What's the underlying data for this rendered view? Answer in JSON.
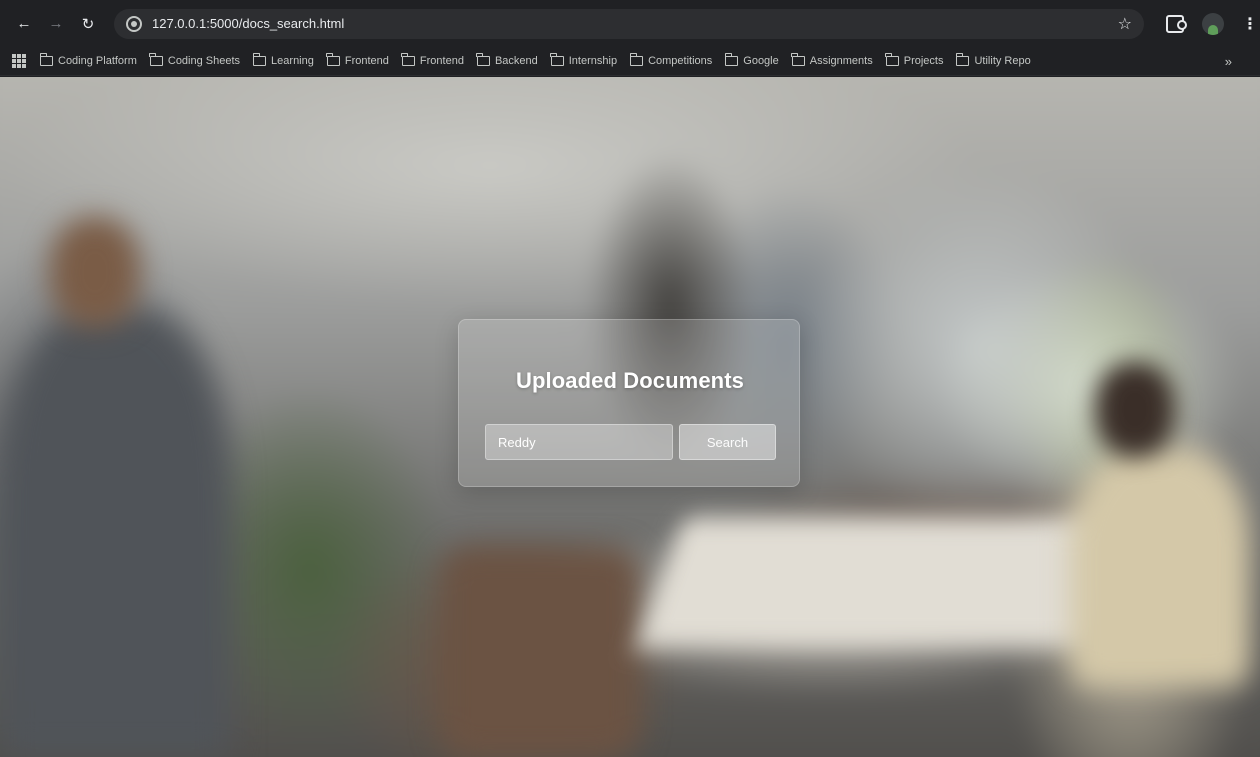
{
  "browser": {
    "url": "127.0.0.1:5000/docs_search.html",
    "nav": {
      "back_icon": "arrow-left-icon",
      "forward_icon": "arrow-right-icon",
      "reload_icon": "reload-icon"
    },
    "toolbar_icons": [
      "star-icon",
      "extensions-icon",
      "avatar",
      "menu-icon"
    ],
    "bookmarks": [
      {
        "label": "Coding Platform"
      },
      {
        "label": "Coding Sheets"
      },
      {
        "label": "Learning"
      },
      {
        "label": "Frontend"
      },
      {
        "label": "Frontend"
      },
      {
        "label": "Backend"
      },
      {
        "label": "Internship"
      },
      {
        "label": "Competitions"
      },
      {
        "label": "Google"
      },
      {
        "label": "Assignments"
      },
      {
        "label": "Projects"
      },
      {
        "label": "Utility Repo"
      }
    ],
    "bookmarks_overflow": "»"
  },
  "page": {
    "card": {
      "title": "Uploaded Documents",
      "search_value": "Reddy",
      "search_button_label": "Search"
    }
  },
  "colors": {
    "chrome_bg": "#202124",
    "omnibox_bg": "#2d2e31",
    "card_text": "#ffffff"
  }
}
